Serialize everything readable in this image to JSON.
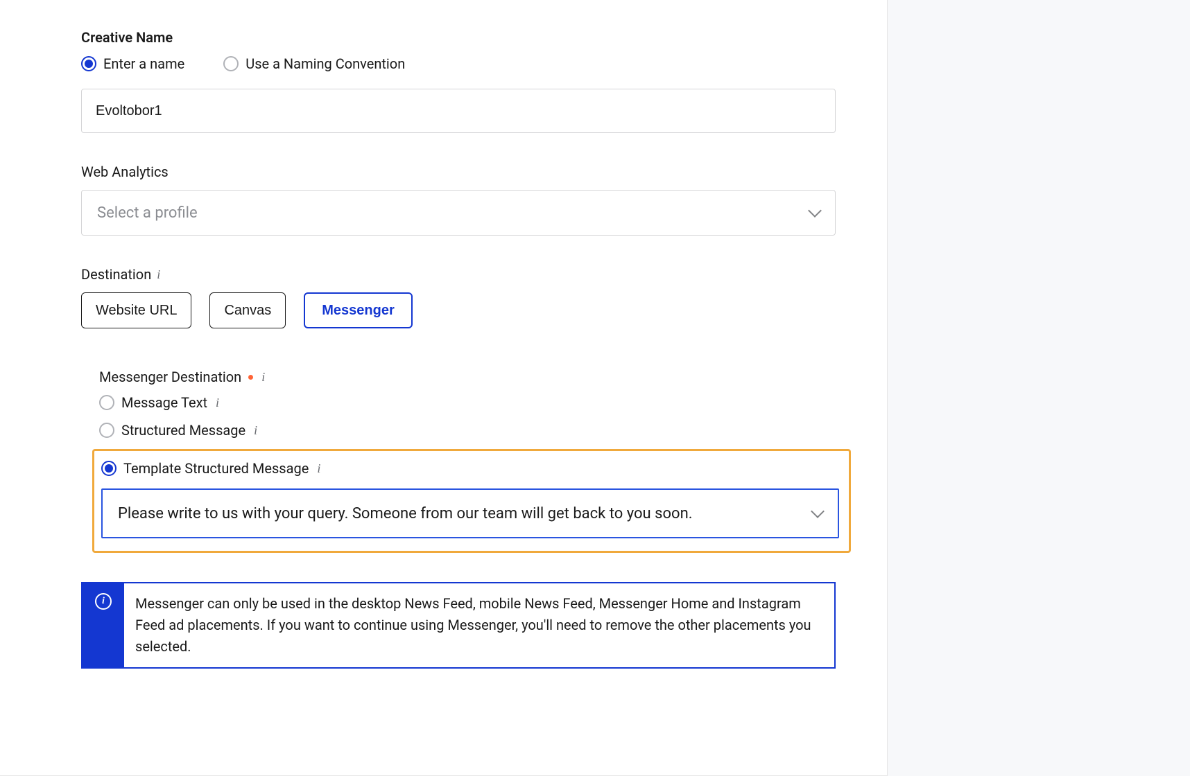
{
  "creative_name": {
    "label": "Creative Name",
    "options": {
      "enter": "Enter a name",
      "convention": "Use a Naming Convention"
    },
    "value": "Evoltobor1"
  },
  "web_analytics": {
    "label": "Web Analytics",
    "placeholder": "Select a profile"
  },
  "destination": {
    "label": "Destination",
    "buttons": {
      "website": "Website URL",
      "canvas": "Canvas",
      "messenger": "Messenger"
    }
  },
  "messenger_destination": {
    "label": "Messenger Destination",
    "options": {
      "message_text": "Message Text",
      "structured": "Structured Message",
      "template": "Template Structured Message"
    },
    "template_value": "Please write to us with your query. Someone from our team will get back to you soon."
  },
  "info_banner": {
    "text": "Messenger can only be used in the desktop News Feed, mobile News Feed, Messenger Home and Instagram Feed ad placements. If you want to continue using Messenger, you'll need to remove the other placements you selected."
  }
}
